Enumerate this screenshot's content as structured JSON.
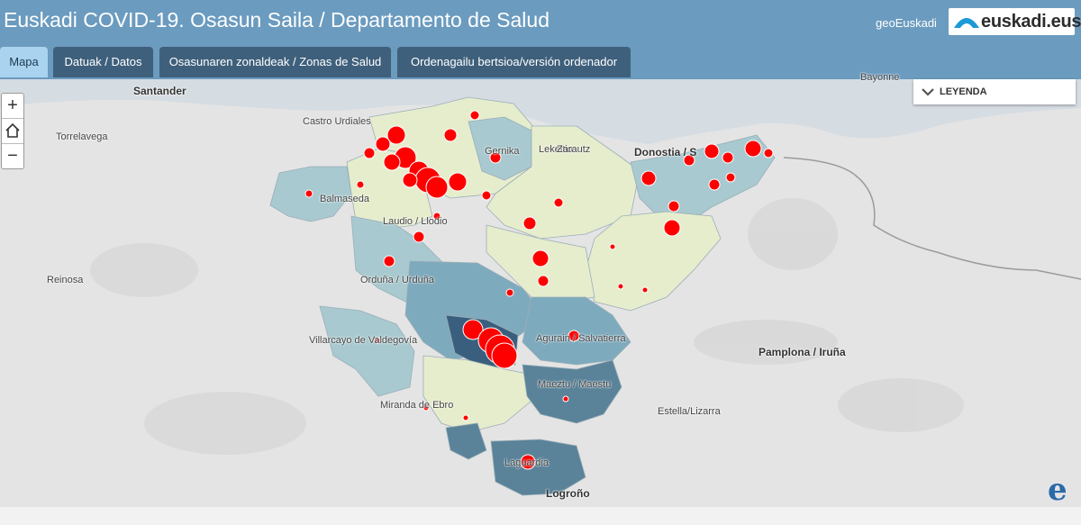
{
  "header": {
    "title": "Euskadi COVID-19. Osasun Saila / Departamento de Salud",
    "geo_link": "geoEuskadi",
    "logo_text": "euskadi.eus"
  },
  "tabs": [
    {
      "label": "Mapa",
      "active": true
    },
    {
      "label": "Datuak / Datos",
      "active": false
    },
    {
      "label": "Osasunaren zonaldeak / Zonas de Salud",
      "active": false
    },
    {
      "label": "Ordenagailu bertsioa/versión ordenador",
      "active": false
    }
  ],
  "legend": {
    "label": "LEYENDA",
    "icon": "chevron-down-icon"
  },
  "map_controls": {
    "zoom_in": "+",
    "home": "home-icon",
    "zoom_out": "−"
  },
  "place_labels": {
    "santander": "Santander",
    "torrelavega": "Torrelavega",
    "castro_urdiales": "Castro Urdiales",
    "reinosa": "Reinosa",
    "donostia": "Donostia / S",
    "bayonne": "Bayonne",
    "pamplona": "Pamplona / Iruña",
    "estella": "Estella/Lizarra",
    "miranda": "Miranda de Ebro",
    "logrono": "Logroño",
    "villarcayo": "Villarcayo de Valdegovía",
    "orduna": "Orduña / Urduña",
    "salvatierra": "Agurain / Salvatierra",
    "maeztu": "Maeztu / Maestu",
    "laguardia": "Laguardia",
    "balmaseda": "Balmaseda",
    "llodio": "Laudio / Llodio",
    "gernika": "Gernika",
    "lekeitio": "Lekeitio",
    "zarautz": "Zarautz"
  },
  "colors": {
    "header_bg": "#6b9bbf",
    "tab_bg": "#3f607c",
    "tab_active_bg": "#a9d3ee",
    "sea": "#d4dbe0",
    "land": "#e4e4e4",
    "zone_light": "#e6edcd",
    "zone_mid": "#a8c9cf",
    "zone_teal": "#7eaabd",
    "zone_dark": "#5a8399",
    "zone_darkest": "#3a5f7e",
    "case_dot": "#ff0000"
  }
}
